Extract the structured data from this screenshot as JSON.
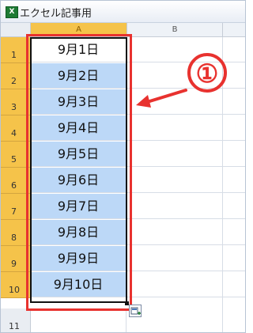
{
  "window": {
    "title": "エクセル記事用"
  },
  "column_headers": [
    "A",
    "B"
  ],
  "rows": [
    {
      "header": "1",
      "value": "9月1日"
    },
    {
      "header": "2",
      "value": "9月2日"
    },
    {
      "header": "3",
      "value": "9月3日"
    },
    {
      "header": "4",
      "value": "9月4日"
    },
    {
      "header": "5",
      "value": "9月5日"
    },
    {
      "header": "6",
      "value": "9月6日"
    },
    {
      "header": "7",
      "value": "9月7日"
    },
    {
      "header": "8",
      "value": "9月8日"
    },
    {
      "header": "9",
      "value": "9月9日"
    },
    {
      "header": "10",
      "value": "9月10日"
    },
    {
      "header": "11",
      "value": ""
    }
  ],
  "annotation": {
    "marker": "①"
  },
  "colors": {
    "selection": "#bcd8f7",
    "header_highlight": "#f5c34a",
    "annotation": "#e8322f"
  },
  "icons": {
    "app": "excel-icon",
    "paste": "paste-options-icon"
  }
}
